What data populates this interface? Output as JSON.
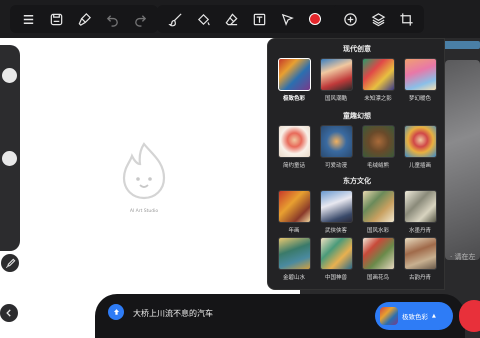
{
  "toolbar": {
    "left_icons": [
      "menu-icon",
      "save-icon",
      "clear-brush-icon",
      "undo-icon",
      "redo-icon"
    ],
    "middle_icons": [
      "brush-icon",
      "fill-icon",
      "eraser-icon",
      "text-icon",
      "select-icon",
      "color-dot",
      "chevron-down-icon"
    ],
    "right_icons": [
      "add-icon",
      "layers-icon",
      "crop-icon"
    ],
    "current_color": "#e4262b"
  },
  "canvas": {
    "empty_text": "AI Art Studio"
  },
  "style_panel": {
    "categories": [
      {
        "title": "现代创意",
        "items": [
          {
            "label": "极致色彩",
            "selected": true
          },
          {
            "label": "国风潮酷",
            "selected": false
          },
          {
            "label": "未知漂之影",
            "selected": false
          },
          {
            "label": "梦幻暖色",
            "selected": false
          }
        ]
      },
      {
        "title": "童趣幻想",
        "items": [
          {
            "label": "简约童话",
            "selected": false
          },
          {
            "label": "可爱动漫",
            "selected": false
          },
          {
            "label": "毛绒绒熊",
            "selected": false
          },
          {
            "label": "儿童插画",
            "selected": false
          }
        ]
      },
      {
        "title": "东方文化",
        "items": [
          {
            "label": "年画",
            "selected": false
          },
          {
            "label": "武侠侠客",
            "selected": false
          },
          {
            "label": "国风水彩",
            "selected": false
          },
          {
            "label": "水墨丹青",
            "selected": false
          },
          {
            "label": "金碧山水",
            "selected": false
          },
          {
            "label": "中国神兽",
            "selected": false
          },
          {
            "label": "国画花鸟",
            "selected": false
          },
          {
            "label": "古韵丹青",
            "selected": false
          }
        ]
      }
    ]
  },
  "right_panel": {
    "hint": "· 请在左"
  },
  "prompt_bar": {
    "text": "大桥上川流不息的汽车",
    "style_button_label": "极致色彩"
  }
}
